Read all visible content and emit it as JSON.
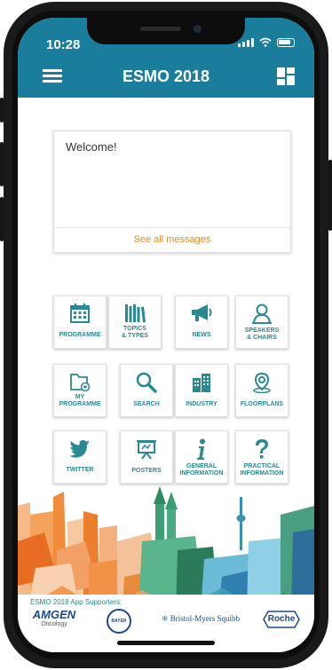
{
  "status": {
    "time": "10:28"
  },
  "header": {
    "title": "ESMO 2018"
  },
  "welcome": {
    "title": "Welcome!",
    "see_all": "See all messages"
  },
  "tiles": [
    {
      "label": "PROGRAMME",
      "icon": "calendar-icon"
    },
    {
      "label": "TOPICS\n& TYPES",
      "icon": "books-icon"
    },
    {
      "label": "NEWS",
      "icon": "megaphone-icon"
    },
    {
      "label": "SPEAKERS\n& CHAIRS",
      "icon": "speaker-person-icon"
    },
    {
      "label": "MY\nPROGRAMME",
      "icon": "folder-heart-icon"
    },
    {
      "label": "SEARCH",
      "icon": "magnifier-icon"
    },
    {
      "label": "INDUSTRY",
      "icon": "buildings-icon"
    },
    {
      "label": "FLOORPLANS",
      "icon": "map-pin-icon"
    },
    {
      "label": "TWITTER",
      "icon": "twitter-bird-icon"
    },
    {
      "label": "POSTERS",
      "icon": "easel-icon"
    },
    {
      "label": "GENERAL\nINFORMATION",
      "icon": "info-icon"
    },
    {
      "label": "PRACTICAL\nINFORMATION",
      "icon": "question-icon"
    }
  ],
  "supporters": {
    "label": "ESMO 2018 App Supporters:",
    "amgen": "AMGEN",
    "amgen_sub": "Oncology",
    "bayer": "BAYER",
    "bms": "Bristol-Myers Squibb",
    "roche": "Roche"
  },
  "colors": {
    "header": "#1a7d9b",
    "tile_icon": "#2a8a92",
    "accent": "#e38b2b"
  }
}
